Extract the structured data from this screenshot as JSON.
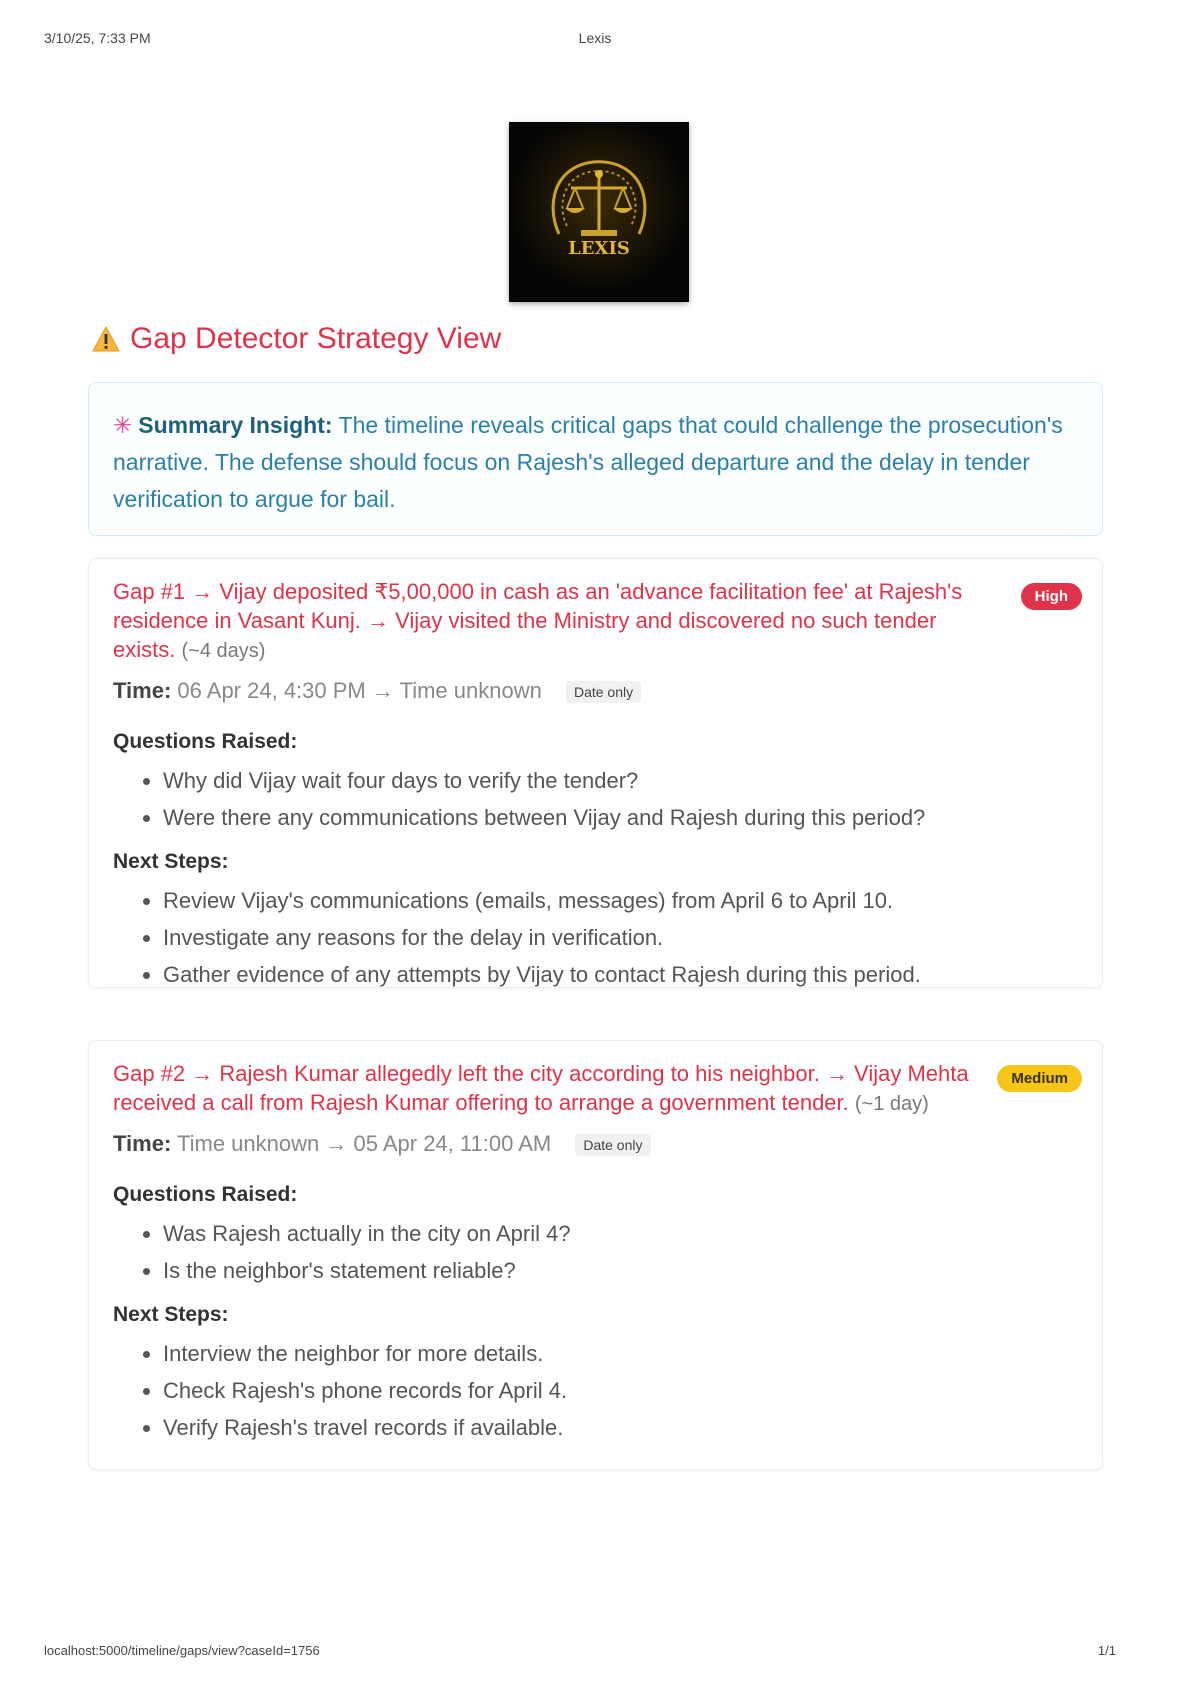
{
  "print_header": {
    "date": "3/10/25, 7:33 PM",
    "title": "Lexis"
  },
  "print_footer": {
    "url": "localhost:5000/timeline/gaps/view?caseId=1756",
    "page": "1/1"
  },
  "logo": {
    "name": "scales-of-justice-logo",
    "text": "LEXIS"
  },
  "page": {
    "heading": "Gap Detector Strategy View",
    "icon": "warning-icon"
  },
  "summary": {
    "icon": "sparkle-icon",
    "label": "Summary Insight:",
    "text": "The timeline reveals critical gaps that could challenge the prosecution's narrative. The defense should focus on Rajesh's alleged departure and the delay in tender verification to argue for bail."
  },
  "gaps": [
    {
      "title": "Gap #1 → Vijay deposited ₹5,00,000 in cash as an 'advance facilitation fee' at Rajesh's residence in Vasant Kunj. → Vijay visited the Ministry and discovered no such tender exists.",
      "duration": "(~4 days)",
      "severity": "High",
      "time_label": "Time:",
      "time_value": "06 Apr 24, 4:30 PM → Time unknown",
      "date_only": "Date only",
      "questions_heading": "Questions Raised:",
      "questions": [
        "Why did Vijay wait four days to verify the tender?",
        "Were there any communications between Vijay and Rajesh during this period?"
      ],
      "steps_heading": "Next Steps:",
      "steps": [
        "Review Vijay's communications (emails, messages) from April 6 to April 10.",
        "Investigate any reasons for the delay in verification.",
        "Gather evidence of any attempts by Vijay to contact Rajesh during this period."
      ]
    },
    {
      "title": "Gap #2 → Rajesh Kumar allegedly left the city according to his neighbor. → Vijay Mehta received a call from Rajesh Kumar offering to arrange a government tender.",
      "duration": "(~1 day)",
      "severity": "Medium",
      "time_label": "Time:",
      "time_value": "Time unknown → 05 Apr 24, 11:00 AM",
      "date_only": "Date only",
      "questions_heading": "Questions Raised:",
      "questions": [
        "Was Rajesh actually in the city on April 4?",
        "Is the neighbor's statement reliable?"
      ],
      "steps_heading": "Next Steps:",
      "steps": [
        "Interview the neighbor for more details.",
        "Check Rajesh's phone records for April 4.",
        "Verify Rajesh's travel records if available."
      ]
    }
  ],
  "colors": {
    "accent_red": "#e0334a",
    "summary_blue": "#2c7fa8",
    "badge_high": "#e0334a",
    "badge_medium": "#f5c518"
  }
}
